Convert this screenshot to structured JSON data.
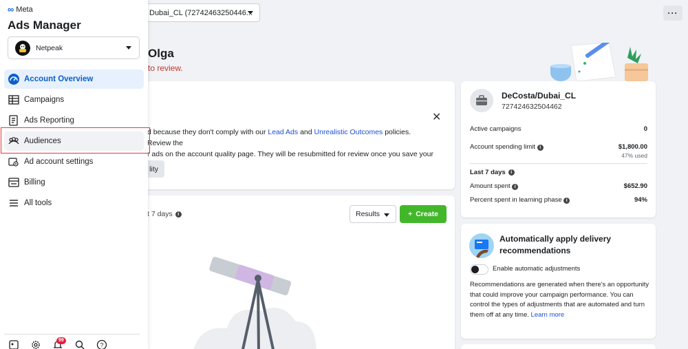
{
  "topbar": {
    "account_value": "Dubai_CL (727424632504462)",
    "account_display": "Dubai_CL (72742463250446..."
  },
  "greeting": {
    "name": "Olga",
    "review_note": "to review."
  },
  "alert": {
    "text_before": "d because they don't comply with our ",
    "link1": "Lead Ads",
    "text_mid": " and ",
    "link2": "Unrealistic Outcomes",
    "text_after": " policies. Review the",
    "line2": "r ads on the account quality page. They will be resubmitted for review once you save your",
    "button_label": "lity"
  },
  "performance": {
    "period_label": "t 7 days",
    "results_label": "Results",
    "create_label": "Create"
  },
  "summary": {
    "account_name": "DeCosta/Dubai_CL",
    "account_id": "727424632504462",
    "active_campaigns_label": "Active campaigns",
    "active_campaigns_value": "0",
    "spending_limit_label": "Account spending limit",
    "spending_limit_value": "$1,800.00",
    "spending_limit_used": "47% used",
    "last7_title": "Last 7 days",
    "amount_spent_label": "Amount spent",
    "amount_spent_value": "$652.90",
    "learning_label": "Percent spent in learning phase",
    "learning_value": "94%"
  },
  "recommendations": {
    "title": "Automatically apply delivery recommendations",
    "toggle_label": "Enable automatic adjustments",
    "description": "Recommendations are generated when there's an opportunity that could improve your campaign performance. You can control the types of adjustments that are automated and turn them off at any time. ",
    "learn_more": "Learn more"
  },
  "sidebar": {
    "brand": "Meta",
    "app_title": "Ads Manager",
    "business": "Netpeak",
    "items": [
      {
        "label": "Account Overview"
      },
      {
        "label": "Campaigns"
      },
      {
        "label": "Ads Reporting"
      },
      {
        "label": "Audiences"
      },
      {
        "label": "Ad account settings"
      },
      {
        "label": "Billing"
      },
      {
        "label": "All tools"
      }
    ],
    "notification_count": "99"
  },
  "colors": {
    "accent": "#0b5fcc",
    "create": "#42b72a",
    "alert_red": "#c0392b",
    "highlight_border": "#e53935"
  }
}
